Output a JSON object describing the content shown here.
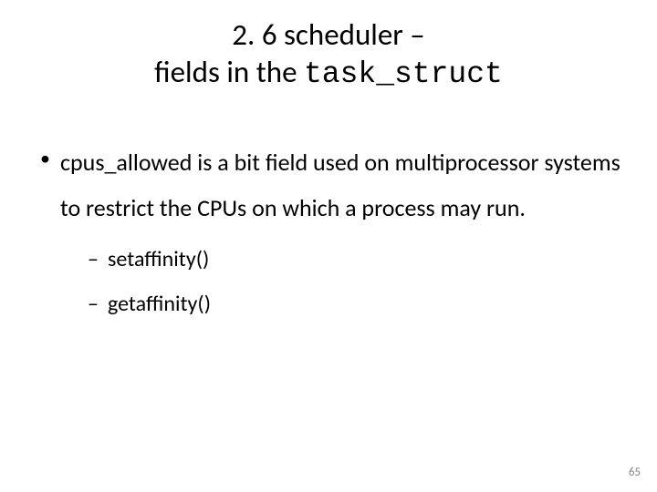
{
  "title": {
    "line1": "2. 6 scheduler –",
    "line2_prefix": "fields in the ",
    "line2_code": "task_struct"
  },
  "body": {
    "bullet1": "cpus_allowed is a bit field used on multiprocessor systems to restrict the CPUs on which a process may run.",
    "sub": [
      "setaffinity()",
      "getaffinity()"
    ]
  },
  "page_number": "65"
}
